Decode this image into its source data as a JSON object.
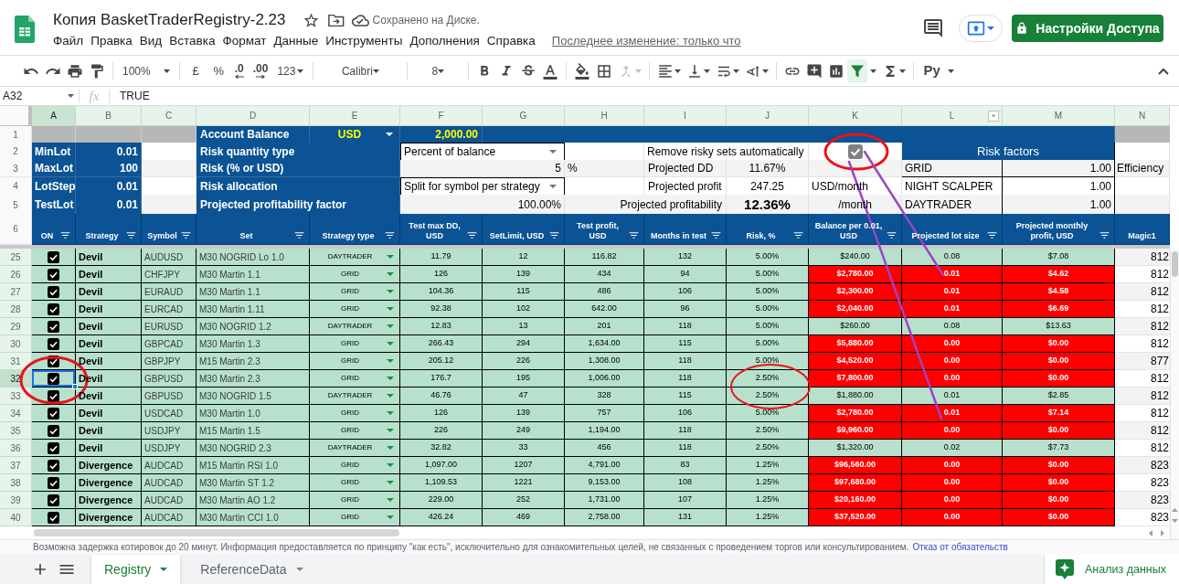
{
  "app": {
    "title": "Копия BasketTraderRegistry-2.23",
    "save_status": "Сохранено на Диске.",
    "share_button": "Настройки Доступа"
  },
  "menu": [
    "Файл",
    "Правка",
    "Вид",
    "Вставка",
    "Формат",
    "Данные",
    "Инструменты",
    "Дополнения",
    "Справка"
  ],
  "last_edit": "Последнее изменение: только что",
  "toolbar": {
    "zoom": "100%",
    "currency": "£",
    "percent": "%",
    "decimal_decrease": ".0",
    "decimal_increase": ".00",
    "number_formats": "123",
    "font": "Calibri",
    "font_size": "8",
    "merge_disabled": true,
    "filter_active": true,
    "input_tool": "Ру"
  },
  "formula_bar": {
    "cell": "A32",
    "fx": "fx",
    "value": "TRUE"
  },
  "column_headers": [
    {
      "label": "A",
      "selected": true,
      "filter_menu": false
    },
    {
      "label": "B",
      "selected": false,
      "filter_menu": false
    },
    {
      "label": "C",
      "selected": false,
      "filter_menu": false
    },
    {
      "label": "D",
      "selected": false,
      "filter_menu": false
    },
    {
      "label": "E",
      "selected": false,
      "filter_menu": false
    },
    {
      "label": "F",
      "selected": false,
      "filter_menu": false
    },
    {
      "label": "G",
      "selected": false,
      "filter_menu": false
    },
    {
      "label": "H",
      "selected": false,
      "filter_menu": false
    },
    {
      "label": "I",
      "selected": false,
      "filter_menu": false
    },
    {
      "label": "J",
      "selected": false,
      "filter_menu": false
    },
    {
      "label": "K",
      "selected": false,
      "filter_menu": false
    },
    {
      "label": "L",
      "selected": false,
      "filter_menu": true
    },
    {
      "label": "M",
      "selected": false,
      "filter_menu": false
    },
    {
      "label": "N",
      "selected": false,
      "filter_menu": false
    }
  ],
  "top_row_numbers": [
    "1",
    "2",
    "3",
    "4",
    "5",
    "6"
  ],
  "top_panel": {
    "account_balance": {
      "label": "Account Balance",
      "currency": "USD",
      "value": "2,000.00"
    },
    "lot_settings": [
      {
        "label": "MinLot",
        "value": "0.01"
      },
      {
        "label": "MaxLot",
        "value": "100"
      },
      {
        "label": "LotStep",
        "value": "0.01"
      },
      {
        "label": "TestLot",
        "value": "0.01"
      }
    ],
    "risk_settings": [
      {
        "label": "Risk quantity type",
        "kind": "dropdown",
        "value": "Percent of balance"
      },
      {
        "label": "Risk (% or USD)",
        "kind": "number",
        "value": "5",
        "unit": "%"
      },
      {
        "label": "Risk allocation",
        "kind": "dropdown",
        "value": "Split for symbol per strategy"
      },
      {
        "label": "Projected profitability factor",
        "kind": "number",
        "value": "100.00%"
      }
    ],
    "auto_remove": {
      "label": "Remove risky sets automatically",
      "checked": true
    },
    "projections": [
      {
        "label": "Projected DD",
        "value": "11.67%",
        "emphasized": false
      },
      {
        "label": "Projected profit",
        "value": "247.25",
        "unit": "USD/month",
        "emphasized": false
      },
      {
        "label": "Projected profitability",
        "value": "12.36%",
        "unit": "/month",
        "emphasized": true
      }
    ],
    "risk_factors": {
      "title": "Risk factors",
      "items": [
        {
          "name": "GRID",
          "value": "1.00"
        },
        {
          "name": "NIGHT SCALPER",
          "value": "1.00"
        },
        {
          "name": "DAYTRADER",
          "value": "1.00"
        }
      ]
    },
    "efficiency_label": "Efficiency"
  },
  "table": {
    "columns": [
      {
        "label": "ON",
        "filter": true
      },
      {
        "label": "Strategy",
        "filter": true
      },
      {
        "label": "Symbol",
        "filter": true
      },
      {
        "label": "Set",
        "filter": true
      },
      {
        "label": "Strategy type",
        "filter": true
      },
      {
        "label": "Test max DD, USD",
        "filter": true
      },
      {
        "label": "SetLimit, USD",
        "filter": true
      },
      {
        "label": "Test profit, USD",
        "filter": true
      },
      {
        "label": "Months in test",
        "filter": true
      },
      {
        "label": "Risk, %",
        "filter": true
      },
      {
        "label": "Balance per 0.01, USD",
        "filter": true
      },
      {
        "label": "Projected lot size",
        "filter": true
      },
      {
        "label": "Projected monthly profit, USD",
        "filter": true
      },
      {
        "label": "Magic1",
        "filter": false
      }
    ],
    "rows": [
      {
        "row": "25",
        "selected": false,
        "on": true,
        "strategy": "Devil",
        "symbol": "AUDUSD",
        "set": "M30 NOGRID Lo 1.0",
        "strategy_type": "DAYTRADER",
        "test_max_dd": "11.79",
        "set_limit": "12",
        "test_profit": "116.82",
        "months": "132",
        "risk": "5.00%",
        "balance_per_lot": "$240.00",
        "lot_size": "0.08",
        "monthly_profit": "$7.08",
        "magic": "812",
        "risky": false
      },
      {
        "row": "26",
        "selected": false,
        "on": true,
        "strategy": "Devil",
        "symbol": "CHFJPY",
        "set": "M30 Martin 1.1",
        "strategy_type": "GRID",
        "test_max_dd": "126",
        "set_limit": "139",
        "test_profit": "434",
        "months": "94",
        "risk": "5.00%",
        "balance_per_lot": "$2,780.00",
        "lot_size": "0.01",
        "monthly_profit": "$4.62",
        "magic": "812",
        "risky": true
      },
      {
        "row": "27",
        "selected": false,
        "on": true,
        "strategy": "Devil",
        "symbol": "EURAUD",
        "set": "M30 Martin 1.1",
        "strategy_type": "GRID",
        "test_max_dd": "104.36",
        "set_limit": "115",
        "test_profit": "486",
        "months": "106",
        "risk": "5.00%",
        "balance_per_lot": "$2,300.00",
        "lot_size": "0.01",
        "monthly_profit": "$4.58",
        "magic": "812",
        "risky": true
      },
      {
        "row": "28",
        "selected": false,
        "on": true,
        "strategy": "Devil",
        "symbol": "EURCAD",
        "set": "M30 Martin 1.11",
        "strategy_type": "GRID",
        "test_max_dd": "92.38",
        "set_limit": "102",
        "test_profit": "642.00",
        "months": "96",
        "risk": "5.00%",
        "balance_per_lot": "$2,040.00",
        "lot_size": "0.01",
        "monthly_profit": "$6.69",
        "magic": "812",
        "risky": true
      },
      {
        "row": "29",
        "selected": false,
        "on": true,
        "strategy": "Devil",
        "symbol": "EURUSD",
        "set": "M30 NOGRID 1.2",
        "strategy_type": "DAYTRADER",
        "test_max_dd": "12.83",
        "set_limit": "13",
        "test_profit": "201",
        "months": "118",
        "risk": "5.00%",
        "balance_per_lot": "$260.00",
        "lot_size": "0.08",
        "monthly_profit": "$13.63",
        "magic": "812",
        "risky": false
      },
      {
        "row": "30",
        "selected": false,
        "on": true,
        "strategy": "Devil",
        "symbol": "GBPCAD",
        "set": "M30 Martin 1.3",
        "strategy_type": "GRID",
        "test_max_dd": "266.43",
        "set_limit": "294",
        "test_profit": "1,634.00",
        "months": "115",
        "risk": "5.00%",
        "balance_per_lot": "$5,880.00",
        "lot_size": "0.00",
        "monthly_profit": "$0.00",
        "magic": "812",
        "risky": true
      },
      {
        "row": "31",
        "selected": false,
        "on": true,
        "strategy": "Devil",
        "symbol": "GBPJPY",
        "set": "M15 Martin 2.3",
        "strategy_type": "GRID",
        "test_max_dd": "205.12",
        "set_limit": "226",
        "test_profit": "1,308.00",
        "months": "118",
        "risk": "5.00%",
        "balance_per_lot": "$4,520.00",
        "lot_size": "0.00",
        "monthly_profit": "$0.00",
        "magic": "877",
        "risky": true
      },
      {
        "row": "32",
        "selected": true,
        "on": true,
        "strategy": "Devil",
        "symbol": "GBPUSD",
        "set": "M30 Martin 2.3",
        "strategy_type": "GRID",
        "test_max_dd": "176.7",
        "set_limit": "195",
        "test_profit": "1,006.00",
        "months": "118",
        "risk": "2.50%",
        "balance_per_lot": "$7,800.00",
        "lot_size": "0.00",
        "monthly_profit": "$0.00",
        "magic": "812",
        "risky": true
      },
      {
        "row": "33",
        "selected": false,
        "on": true,
        "strategy": "Devil",
        "symbol": "GBPUSD",
        "set": "M30 NOGRID 1.5",
        "strategy_type": "DAYTRADER",
        "test_max_dd": "46.76",
        "set_limit": "47",
        "test_profit": "328",
        "months": "115",
        "risk": "2.50%",
        "balance_per_lot": "$1,880.00",
        "lot_size": "0.01",
        "monthly_profit": "$2.85",
        "magic": "812",
        "risky": false
      },
      {
        "row": "34",
        "selected": false,
        "on": true,
        "strategy": "Devil",
        "symbol": "USDCAD",
        "set": "M30 Martin 1.0",
        "strategy_type": "GRID",
        "test_max_dd": "126",
        "set_limit": "139",
        "test_profit": "757",
        "months": "106",
        "risk": "5.00%",
        "balance_per_lot": "$2,780.00",
        "lot_size": "0.01",
        "monthly_profit": "$7.14",
        "magic": "812",
        "risky": true
      },
      {
        "row": "35",
        "selected": false,
        "on": true,
        "strategy": "Devil",
        "symbol": "USDJPY",
        "set": "M15 Martin 1.5",
        "strategy_type": "GRID",
        "test_max_dd": "226",
        "set_limit": "249",
        "test_profit": "1,194.00",
        "months": "118",
        "risk": "2.50%",
        "balance_per_lot": "$9,960.00",
        "lot_size": "0.00",
        "monthly_profit": "$0.00",
        "magic": "812",
        "risky": true
      },
      {
        "row": "36",
        "selected": false,
        "on": true,
        "strategy": "Devil",
        "symbol": "USDJPY",
        "set": "M30 NOGRID 2.3",
        "strategy_type": "DAYTRADER",
        "test_max_dd": "32.82",
        "set_limit": "33",
        "test_profit": "456",
        "months": "118",
        "risk": "2.50%",
        "balance_per_lot": "$1,320.00",
        "lot_size": "0.02",
        "monthly_profit": "$7.73",
        "magic": "812",
        "risky": false
      },
      {
        "row": "37",
        "selected": false,
        "on": true,
        "strategy": "Divergence",
        "symbol": "AUDCAD",
        "set": "M15 Martin RSI 1.0",
        "strategy_type": "GRID",
        "test_max_dd": "1,097.00",
        "set_limit": "1207",
        "test_profit": "4,791.00",
        "months": "83",
        "risk": "1.25%",
        "balance_per_lot": "$96,560.00",
        "lot_size": "0.00",
        "monthly_profit": "$0.00",
        "magic": "823",
        "risky": true
      },
      {
        "row": "38",
        "selected": false,
        "on": true,
        "strategy": "Divergence",
        "symbol": "AUDCAD",
        "set": "M30 Martin ST 1.2",
        "strategy_type": "GRID",
        "test_max_dd": "1,109.53",
        "set_limit": "1221",
        "test_profit": "9,153.00",
        "months": "108",
        "risk": "1.25%",
        "balance_per_lot": "$97,680.00",
        "lot_size": "0.00",
        "monthly_profit": "$0.00",
        "magic": "823",
        "risky": true
      },
      {
        "row": "39",
        "selected": false,
        "on": true,
        "strategy": "Divergence",
        "symbol": "AUDCAD",
        "set": "M30 Martin AO 1.2",
        "strategy_type": "GRID",
        "test_max_dd": "229.00",
        "set_limit": "252",
        "test_profit": "1,731.00",
        "months": "107",
        "risk": "1.25%",
        "balance_per_lot": "$20,160.00",
        "lot_size": "0.00",
        "monthly_profit": "$0.00",
        "magic": "823",
        "risky": true
      },
      {
        "row": "40",
        "selected": false,
        "on": true,
        "strategy": "Divergence",
        "symbol": "AUDCAD",
        "set": "M30 Martin CCI 1.0",
        "strategy_type": "GRID",
        "test_max_dd": "426.24",
        "set_limit": "469",
        "test_profit": "2,758.00",
        "months": "131",
        "risk": "1.25%",
        "balance_per_lot": "$37,520.00",
        "lot_size": "0.00",
        "monthly_profit": "$0.00",
        "magic": "823",
        "risky": true
      }
    ]
  },
  "footer": {
    "notice": "Возможна задержка котировок до 20 минут. Информация предоставляется по принципу \"как есть\", исключительно для ознакомительных целей, не связанных с проведением торгов или консультированием.",
    "link": "Отказ от обязательств"
  },
  "sheet_tabs": [
    {
      "label": "Registry",
      "selected": true
    },
    {
      "label": "ReferenceData",
      "selected": false
    }
  ],
  "explore_button": "Анализ данных"
}
